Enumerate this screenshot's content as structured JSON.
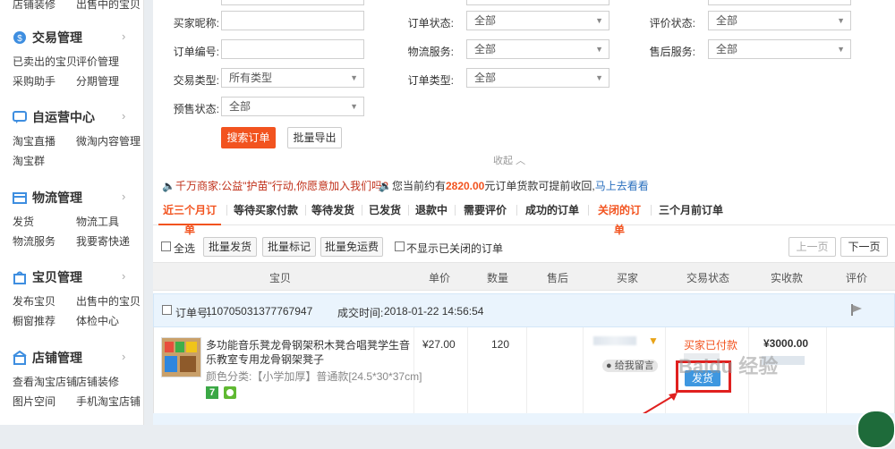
{
  "sidebar": {
    "top_links": [
      "店铺装修",
      "出售中的宝贝"
    ],
    "sections": [
      {
        "title": "交易管理",
        "icon": "trade-icon",
        "links": [
          "已卖出的宝贝",
          "评价管理",
          "采购助手",
          "分期管理"
        ]
      },
      {
        "title": "自运营中心",
        "icon": "chat-icon",
        "links": [
          "淘宝直播",
          "微淘内容管理",
          "淘宝群"
        ]
      },
      {
        "title": "物流管理",
        "icon": "logistics-icon",
        "links": [
          "发货",
          "物流工具",
          "物流服务",
          "我要寄快递"
        ]
      },
      {
        "title": "宝贝管理",
        "icon": "goods-icon",
        "links": [
          "发布宝贝",
          "出售中的宝贝",
          "橱窗推荐",
          "体检中心"
        ]
      },
      {
        "title": "店铺管理",
        "icon": "shop-icon",
        "links": [
          "查看淘宝店铺",
          "店铺装修",
          "图片空间",
          "手机淘宝店铺"
        ]
      }
    ]
  },
  "filters": {
    "buyer_nick": {
      "label": "买家昵称:",
      "value": ""
    },
    "order_no": {
      "label": "订单编号:",
      "value": ""
    },
    "trade_type": {
      "label": "交易类型:",
      "value": "所有类型"
    },
    "presale": {
      "label": "预售状态:",
      "value": "全部"
    },
    "order_status": {
      "label": "订单状态:",
      "value": "全部"
    },
    "logistics": {
      "label": "物流服务:",
      "value": "全部"
    },
    "order_type": {
      "label": "订单类型:",
      "value": "全部"
    },
    "rating": {
      "label": "评价状态:",
      "value": "全部"
    },
    "after_sale": {
      "label": "售后服务:",
      "value": "全部"
    },
    "search_button": "搜索订单",
    "export_button": "批量导出",
    "collapse": "收起"
  },
  "notices": {
    "left": "千万商家:公益\"护苗\"行动,你愿意加入我们吗?",
    "right_prefix": "您当前约有",
    "right_amount": "2820.00",
    "right_suffix": "元订单货款可提前收回,",
    "right_link": "马上去看看"
  },
  "tabs": [
    "近三个月订单",
    "等待买家付款",
    "等待发货",
    "已发货",
    "退款中",
    "需要评价",
    "成功的订单",
    "关闭的订单",
    "三个月前订单"
  ],
  "toolbar": {
    "select_all": "全选",
    "batch_ship": "批量发货",
    "batch_mark": "批量标记",
    "batch_free": "批量免运费",
    "hide_closed": "不显示已关闭的订单",
    "prev": "上一页",
    "next": "下一页"
  },
  "table_headers": [
    "宝贝",
    "单价",
    "数量",
    "售后",
    "买家",
    "交易状态",
    "实收款",
    "评价"
  ],
  "order": {
    "order_no_label": "订单号:",
    "order_no": "110705031377767947",
    "time_label": "成交时间:",
    "time": "2018-01-22 14:56:54",
    "title": "多功能音乐凳龙骨钢架积木凳合唱凳学生音乐教室专用龙骨钢架凳子",
    "sku_label": "颜色分类:",
    "sku_value": "【小学加厚】普通款[24.5*30*37cm]",
    "price": "¥27.00",
    "qty": "120",
    "buyer_msg": "给我留言",
    "status": "买家已付款",
    "ship_button": "发货",
    "received": "¥3000.00",
    "colors": {
      "accent": "#f2531f",
      "highlight_box": "#e0201f",
      "ship_btn": "#3e97e0"
    }
  }
}
